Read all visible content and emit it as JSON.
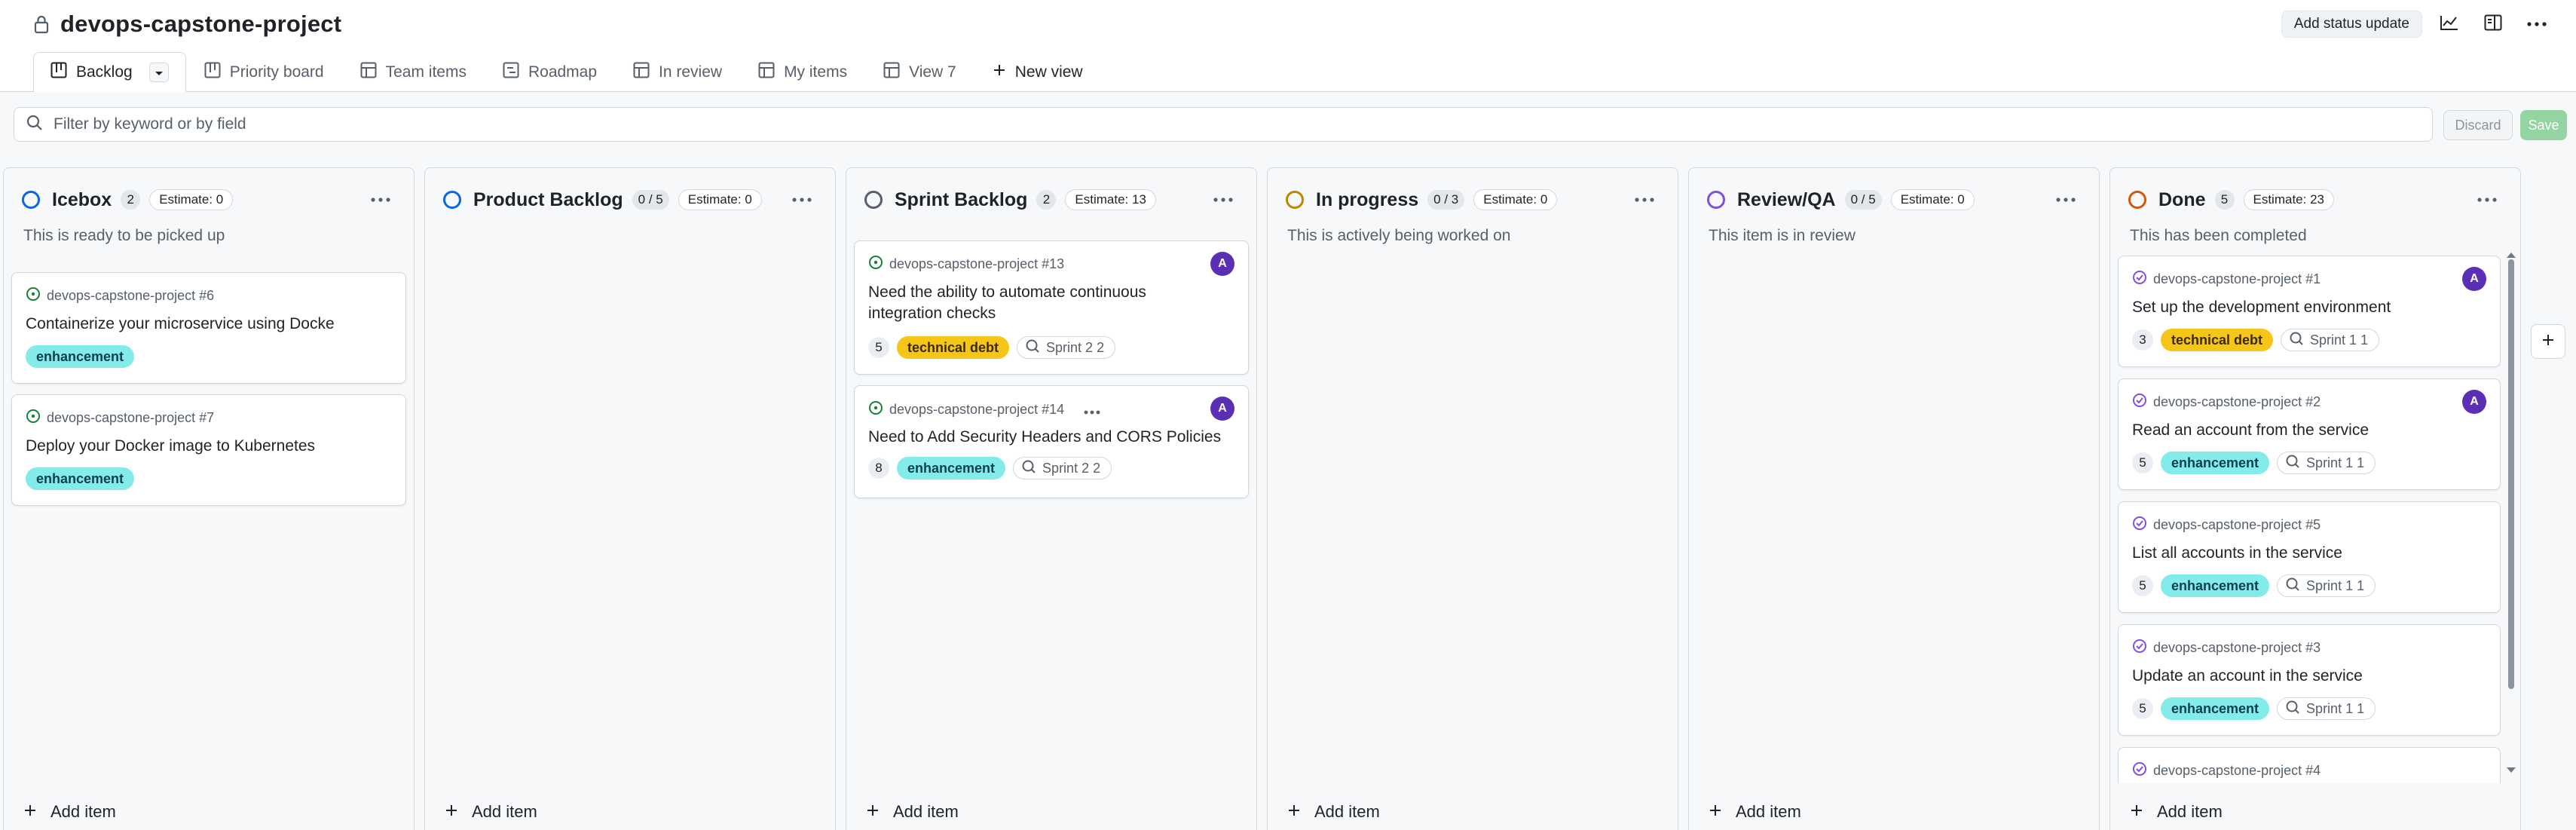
{
  "project": {
    "title": "devops-capstone-project"
  },
  "header": {
    "status_update_label": "Add status update"
  },
  "tabs": [
    {
      "label": "Backlog",
      "icon": "board-icon"
    },
    {
      "label": "Priority board",
      "icon": "board-icon"
    },
    {
      "label": "Team items",
      "icon": "table-icon"
    },
    {
      "label": "Roadmap",
      "icon": "roadmap-icon"
    },
    {
      "label": "In review",
      "icon": "table-icon"
    },
    {
      "label": "My items",
      "icon": "table-icon"
    },
    {
      "label": "View 7",
      "icon": "table-icon"
    },
    {
      "label": "New view",
      "icon": "plus-icon"
    }
  ],
  "filter": {
    "placeholder": "Filter by keyword or by field",
    "discard_label": "Discard",
    "save_label": "Save"
  },
  "colors": {
    "accent_blue": "#0969da",
    "enhancement_bg": "#84ebeb",
    "tech_debt_bg": "#f5c518",
    "in_progress": "#bf8700",
    "review": "#8250df",
    "done": "#d1580c",
    "avatar": "#5b2fb5"
  },
  "columns": [
    {
      "title": "Icebox",
      "count": "2",
      "estimate": "Estimate: 0",
      "description": "This is ready to be picked up",
      "status_color": "#0969da",
      "add_item": "Add item",
      "cards": [
        {
          "ref": "devops-capstone-project #6",
          "title": "Containerize your microservice using Docke",
          "points": "",
          "labels": [
            "enhancement"
          ],
          "sprint": "",
          "avatar": ""
        },
        {
          "ref": "devops-capstone-project #7",
          "title": "Deploy your Docker image to Kubernetes",
          "points": "",
          "labels": [
            "enhancement"
          ],
          "sprint": "",
          "avatar": ""
        }
      ]
    },
    {
      "title": "Product Backlog",
      "count": "0 / 5",
      "estimate": "Estimate: 0",
      "description": "",
      "status_color": "#0969da",
      "add_item": "Add item",
      "cards": []
    },
    {
      "title": "Sprint Backlog",
      "count": "2",
      "estimate": "Estimate: 13",
      "description": "",
      "status_color": "#57606a",
      "add_item": "Add item",
      "cards": [
        {
          "ref": "devops-capstone-project #13",
          "title": "Need the ability to automate continuous integration checks",
          "points": "5",
          "labels": [
            "technical debt"
          ],
          "sprint": "Sprint 2 2",
          "avatar": "A"
        },
        {
          "ref": "devops-capstone-project #14",
          "title": "Need to Add Security Headers and CORS Policies",
          "points": "8",
          "labels": [
            "enhancement"
          ],
          "sprint": "Sprint 2 2",
          "avatar": "A"
        }
      ]
    },
    {
      "title": "In progress",
      "count": "0 / 3",
      "estimate": "Estimate: 0",
      "description": "This is actively being worked on",
      "status_color": "#bf8700",
      "add_item": "Add item",
      "cards": []
    },
    {
      "title": "Review/QA",
      "count": "0 / 5",
      "estimate": "Estimate: 0",
      "description": "This item is in review",
      "status_color": "#8250df",
      "add_item": "Add item",
      "cards": []
    },
    {
      "title": "Done",
      "count": "5",
      "estimate": "Estimate: 23",
      "description": "This has been completed",
      "status_color": "#d1580c",
      "add_item": "Add item",
      "cards": [
        {
          "ref": "devops-capstone-project #1",
          "title": "Set up the development environment",
          "points": "3",
          "labels": [
            "technical debt"
          ],
          "sprint": "Sprint 1 1",
          "avatar": "A"
        },
        {
          "ref": "devops-capstone-project #2",
          "title": "Read an account from the service",
          "points": "5",
          "labels": [
            "enhancement"
          ],
          "sprint": "Sprint 1 1",
          "avatar": "A"
        },
        {
          "ref": "devops-capstone-project #5",
          "title": "List all accounts in the service",
          "points": "5",
          "labels": [
            "enhancement"
          ],
          "sprint": "Sprint 1 1",
          "avatar": ""
        },
        {
          "ref": "devops-capstone-project #3",
          "title": "Update an account in the service",
          "points": "5",
          "labels": [
            "enhancement"
          ],
          "sprint": "Sprint 1 1",
          "avatar": ""
        },
        {
          "ref": "devops-capstone-project #4",
          "title": "",
          "points": "",
          "labels": [],
          "sprint": "",
          "avatar": ""
        }
      ]
    }
  ]
}
